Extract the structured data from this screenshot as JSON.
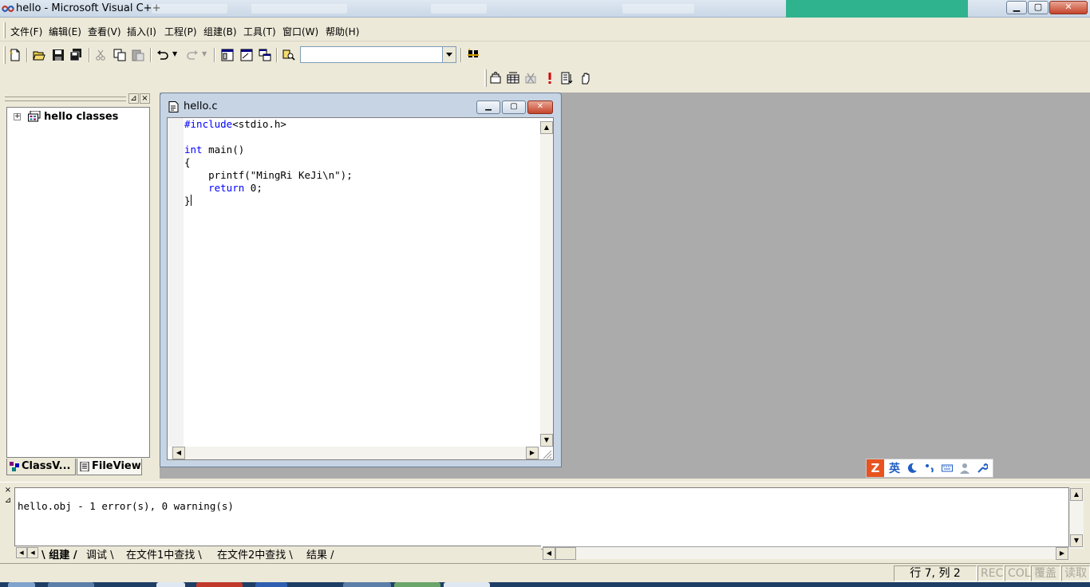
{
  "window": {
    "title": "hello - Microsoft Visual C++",
    "buttons": {
      "minimize": "▁",
      "maximize": "▢",
      "close": "✕"
    }
  },
  "menu": {
    "items": [
      "文件(F)",
      "编辑(E)",
      "查看(V)",
      "插入(I)",
      "工程(P)",
      "组建(B)",
      "工具(T)",
      "窗口(W)",
      "帮助(H)"
    ]
  },
  "toolbar": {
    "find_value": "",
    "icons": [
      "new-file-icon",
      "open-icon",
      "save-icon",
      "save-all-icon",
      "cut-icon",
      "copy-icon",
      "paste-icon",
      "undo-icon",
      "redo-icon",
      "workspace-icon",
      "output-icon",
      "window-list-icon",
      "find-in-files-icon",
      "search-icon"
    ],
    "build_icons": [
      "compile-icon",
      "build-icon",
      "stop-build-icon",
      "execute-icon",
      "go-icon",
      "breakpoint-icon"
    ]
  },
  "workspace": {
    "tree_root": "hello classes",
    "tabs": [
      "ClassV...",
      "FileView"
    ]
  },
  "editor": {
    "title": "hello.c",
    "code": [
      {
        "t": "kw",
        "text": "#include"
      },
      {
        "t": "plain",
        "text": "<stdio.h>"
      }
    ],
    "lines": [
      [
        {
          "k": false,
          "s": ""
        },
        {
          "k": true,
          "s": "#include"
        },
        {
          "k": false,
          "s": "<stdio.h>"
        }
      ],
      [
        {
          "k": false,
          "s": ""
        }
      ],
      [
        {
          "k": true,
          "s": "int"
        },
        {
          "k": false,
          "s": " main()"
        }
      ],
      [
        {
          "k": false,
          "s": "{"
        }
      ],
      [
        {
          "k": false,
          "s": "    printf(\"MingRi KeJi\\n\");"
        }
      ],
      [
        {
          "k": false,
          "s": "    "
        },
        {
          "k": true,
          "s": "return"
        },
        {
          "k": false,
          "s": " 0;"
        }
      ],
      [
        {
          "k": false,
          "s": "}"
        }
      ]
    ]
  },
  "ime": {
    "logo": "Z",
    "lang": "英"
  },
  "output": {
    "message": "hello.obj - 1 error(s), 0 warning(s)",
    "tabs": [
      "组建",
      "调试",
      "在文件1中查找",
      "在文件2中查找",
      "结果"
    ]
  },
  "status": {
    "position": "行 7, 列 2",
    "rec": "REC",
    "col": "COL",
    "ovr": "覆盖",
    "read": "读取"
  },
  "colors": {
    "keyword": "#0000ff",
    "mdi_background": "#ababab",
    "chrome": "#ece9d8"
  }
}
